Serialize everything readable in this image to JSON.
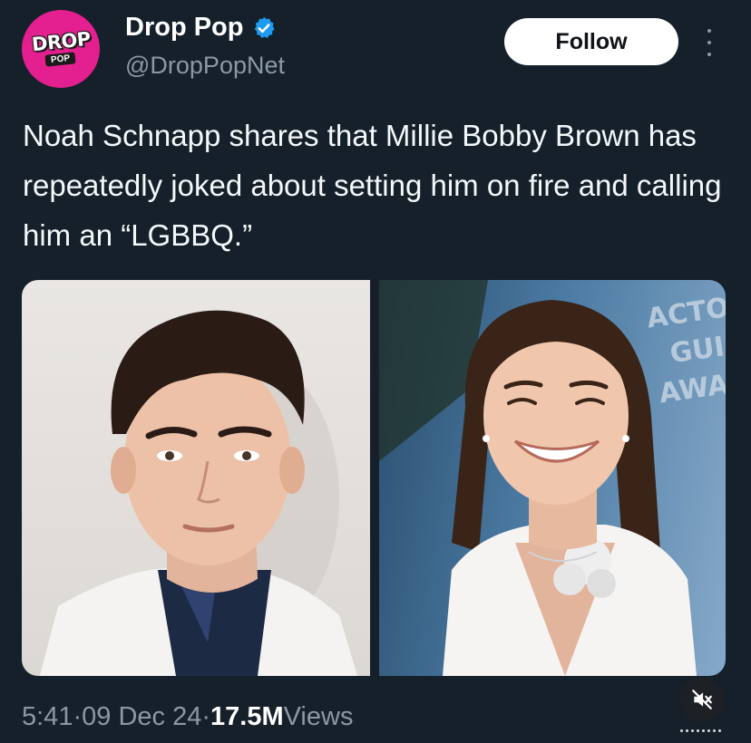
{
  "account": {
    "logo_main": "DROP",
    "logo_sub": "POP",
    "display_name": "Drop Pop",
    "handle": "@DropPopNet",
    "verified": true,
    "follow_label": "Follow"
  },
  "tweet": {
    "text": "Noah Schnapp shares that Millie Bobby Brown has repeatedly joked about setting him on fire and calling him an “LGBBQ.”"
  },
  "media": {
    "background_sign_text": [
      "ACTO",
      "GUIL",
      "AWARD"
    ]
  },
  "meta": {
    "time": "5:41",
    "separator": " · ",
    "date": "09 Dec 24",
    "views_count": "17.5M",
    "views_label": " Views"
  },
  "colors": {
    "background": "#15202b",
    "brand_pink": "#e41f8f",
    "verified_blue": "#1d9bf0",
    "secondary_text": "#8b98a5"
  },
  "icons": {
    "verified": "verified-badge-icon",
    "more": "more-vertical-icon",
    "mute": "muted-speaker-icon"
  }
}
